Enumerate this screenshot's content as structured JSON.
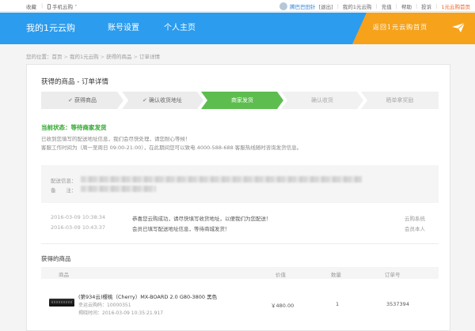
{
  "topbar": {
    "favorite": "收藏",
    "mobile": "手机云购",
    "user": "腾巴巴田针",
    "logout": "[退出]",
    "my_account": "我的1元云购",
    "recharge": "充值",
    "help": "帮助",
    "complaint": "投诉",
    "home": "1元云购首页"
  },
  "header": {
    "nav": [
      "我的1元云购",
      "账号设置",
      "个人主页"
    ],
    "promo": "返回1元云购首页"
  },
  "breadcrumb": [
    "您的位置：首页",
    "我的1元云购",
    "获得的商品",
    "订单详情"
  ],
  "page": {
    "title": "获得的商品 - 订单详情"
  },
  "steps": [
    {
      "label": "获得商品",
      "done": true
    },
    {
      "label": "确认收货地址",
      "done": true
    },
    {
      "label": "商家发货",
      "active": true
    },
    {
      "label": "确认收货"
    },
    {
      "label": "晒单拿奖励"
    }
  ],
  "status": {
    "label": "当前状态：",
    "value": "等待商家发货",
    "line1": "已收到您填写的配送地址信息，我们会尽快处理，请您耐心等候！",
    "line2": "客服工作时间为（周一至周日 09:00-21:00），在此期间您可以致电 4000-588-688 客服热线随时咨询发货信息。"
  },
  "address": {
    "label1": "配送信息：",
    "label2": "备　　注："
  },
  "log": [
    {
      "time": "2016-03-09 10:38:34",
      "msg": "恭喜您云购成功，请尽快填写收货地址，以便我们为您配送！",
      "who": "云购系统"
    },
    {
      "time": "2016-03-09 10:43:37",
      "msg": "会员已填写配送地址信息，等待商城发货！",
      "who": "会员本人"
    }
  ],
  "goods": {
    "title": "获得的商品",
    "headers": {
      "product": "商品",
      "price": "价值",
      "qty": "数量",
      "order": "订单号"
    },
    "item": {
      "name": "(第934云)樱桃（Cherry）MX-BOARD 2.0 G80-3800 黑色",
      "lucky": "幸运云购码：10000351",
      "time": "揭晓时间：2016-03-09 10:35:21.917",
      "price": "￥480.00",
      "qty": "1",
      "order": "3537394"
    }
  },
  "colors": {
    "brand_blue": "#2b9cee",
    "promo_orange": "#f6a21b",
    "step_active": "#5dbd4e",
    "status_green": "#2aa52a"
  }
}
